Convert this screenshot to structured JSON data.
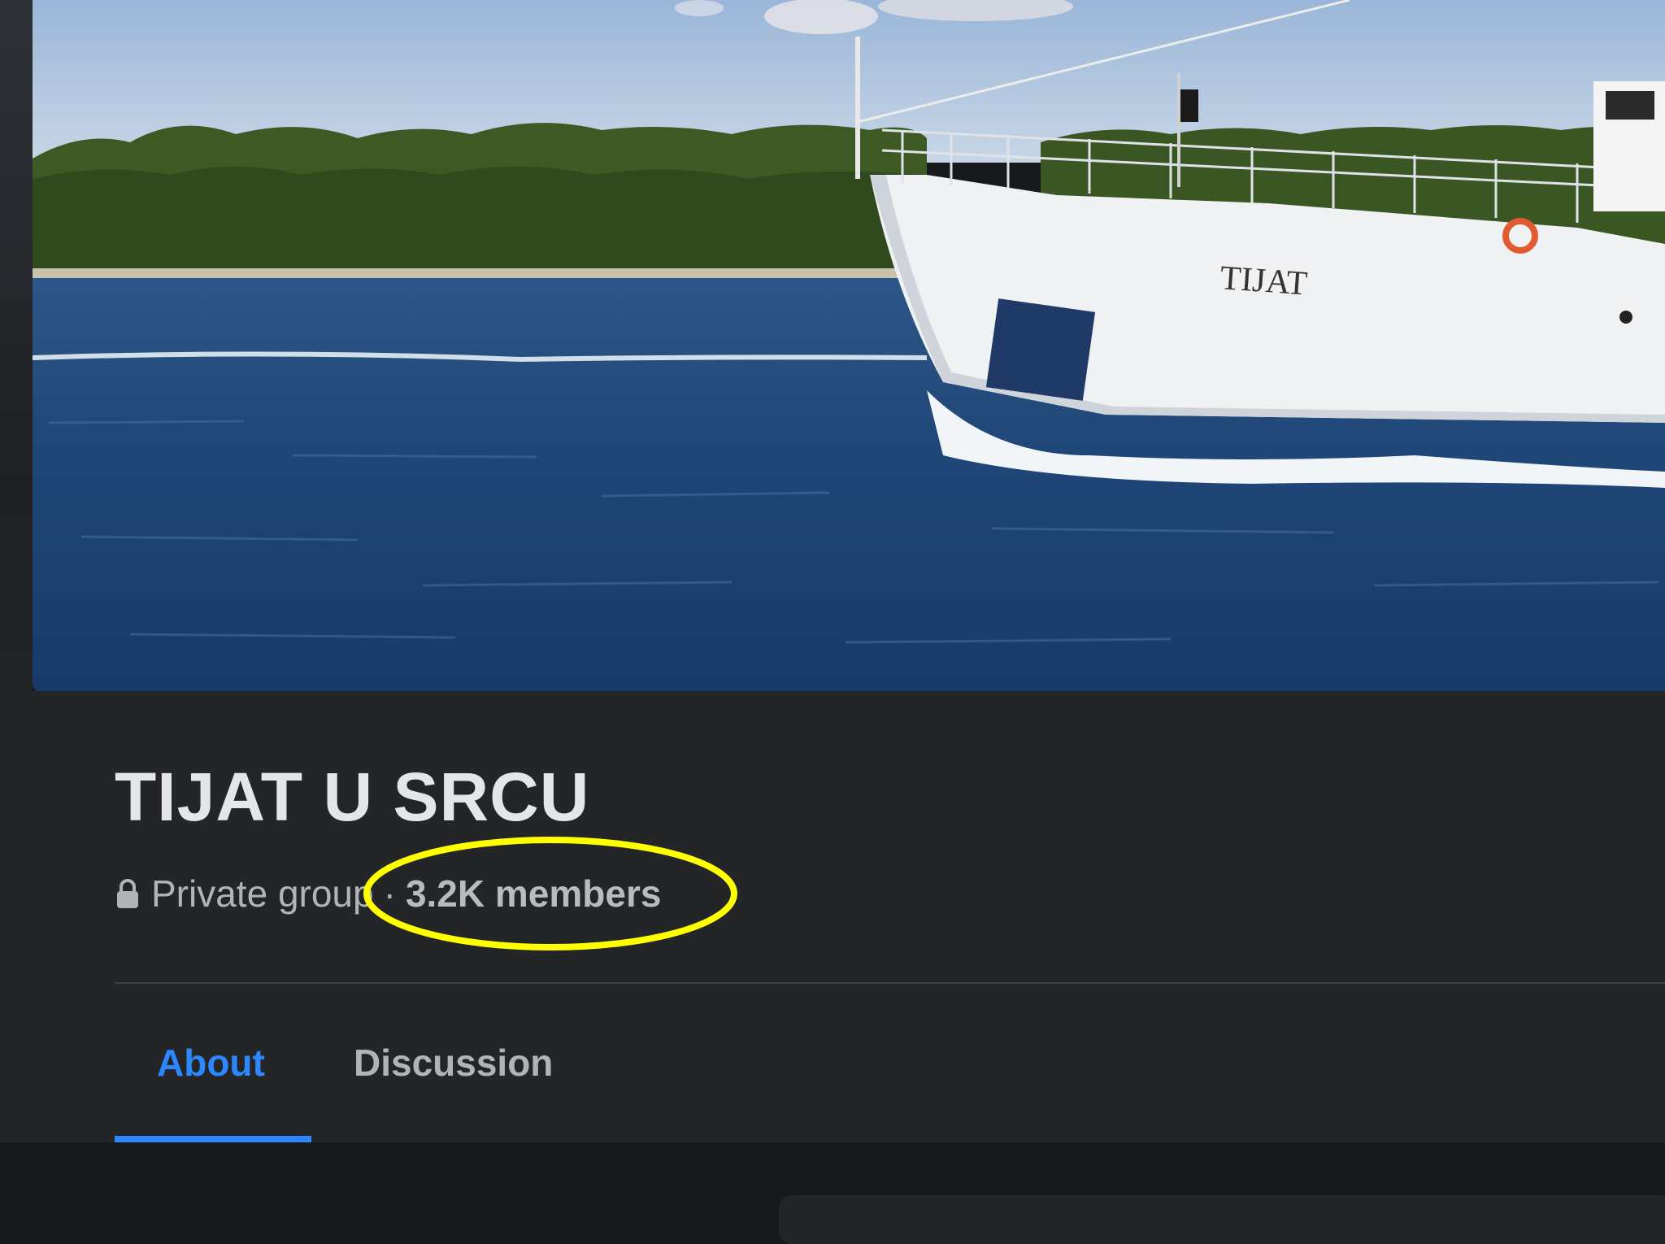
{
  "group": {
    "name": "TIJAT U SRCU",
    "privacy_label": "Private group",
    "separator": "·",
    "members_label": "3.2K members"
  },
  "cover": {
    "boat_name": "TIJAT"
  },
  "tabs": [
    {
      "label": "About",
      "active": true
    },
    {
      "label": "Discussion",
      "active": false
    }
  ],
  "icons": {
    "privacy": "lock-icon"
  },
  "colors": {
    "accent": "#2d88ff",
    "annotation": "#ffff00",
    "background": "#18191a",
    "panel": "#242526"
  }
}
